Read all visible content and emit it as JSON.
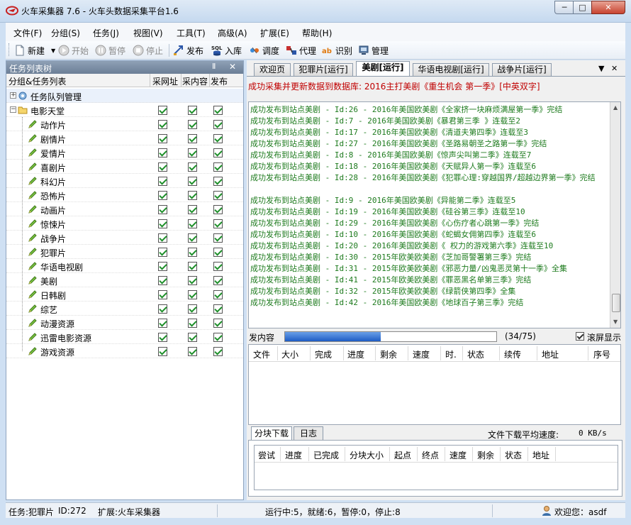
{
  "window": {
    "title": "火车采集器 7.6 - 火车头数据采集平台1.6",
    "min": "─",
    "max": "□",
    "close": "✕"
  },
  "menu": [
    "文件(F)",
    "分组(S)",
    "任务(J)",
    "视图(V)",
    "工具(T)",
    "高级(A)",
    "扩展(E)",
    "帮助(H)"
  ],
  "toolbar": {
    "new": "新建",
    "start": "开始",
    "pause": "暂停",
    "stop": "停止",
    "publish": "发布",
    "import": "入库",
    "schedule": "调度",
    "proxy": "代理",
    "recognize": "识别",
    "manage": "管理"
  },
  "task_tree": {
    "panel_title": "任务列表树",
    "pin": "Ⅱ",
    "close": "✕",
    "columns": [
      "分组&任务列表",
      "采网址",
      "采内容",
      "发布"
    ],
    "queue_label": "任务队列管理",
    "group_label": "电影天堂",
    "items": [
      "动作片",
      "剧情片",
      "爱情片",
      "喜剧片",
      "科幻片",
      "恐怖片",
      "动画片",
      "惊悚片",
      "战争片",
      "犯罪片",
      "华语电视剧",
      "美剧",
      "日韩剧",
      "综艺",
      "动漫资源",
      "迅雷电影资源",
      "游戏资源"
    ]
  },
  "tabs": {
    "items": [
      "欢迎页",
      "犯罪片[运行]",
      "美剧[运行]",
      "华语电视剧[运行]",
      "战争片[运行]"
    ],
    "active": 2,
    "menu": "▼",
    "close": "✕"
  },
  "status_message": "成功采集并更新数据到数据库: 2016主打美剧《重生机会 第一季》[中英双字]",
  "log": [
    "成功发布到站点美剧 - Id:26 - 2016年美国欧美剧《全家挤一块麻烦满屋第一季》完结",
    "成功发布到站点美剧 - Id:7 - 2016年美国欧美剧《暴君第三季 》连载至2",
    "成功发布到站点美剧 - Id:17 - 2016年美国欧美剧《清道夫第四季》连载至3",
    "成功发布到站点美剧 - Id:27 - 2016年美国欧美剧《圣路易朝圣之路第一季》完结",
    "成功发布到站点美剧 - Id:8 - 2016年美国欧美剧《惊声尖叫第二季》连载至7",
    "成功发布到站点美剧 - Id:18 - 2016年美国欧美剧《天赋异人第一季》连载至6",
    "成功发布到站点美剧 - Id:28 - 2016年美国欧美剧《犯罪心理:穿越国界/超越边界第一季》完结",
    "成功发布到站点美剧 - Id:9 - 2016年美国欧美剧《异能第二季》连载至5",
    "成功发布到站点美剧 - Id:19 - 2016年美国欧美剧《硅谷第三季》连载至10",
    "成功发布到站点美剧 - Id:29 - 2016年美国欧美剧《心伤疗者心跳第一季》完结",
    "成功发布到站点美剧 - Id:10 - 2016年美国欧美剧《蛇蝎女佣第四季》连载至6",
    "成功发布到站点美剧 - Id:20 - 2016年美国欧美剧《 权力的游戏第六季》连载至10",
    "成功发布到站点美剧 - Id:30 - 2015年欧美欧美剧《芝加哥警署第三季》完结",
    "成功发布到站点美剧 - Id:31 - 2015年欧美欧美剧《邪恶力量/凶鬼恶灵第十一季》全集",
    "成功发布到站点美剧 - Id:41 - 2015年欧美欧美剧《罪恶黑名单第三季》完结",
    "成功发布到站点美剧 - Id:32 - 2015年欧美欧美剧《绿箭侠第四季》全集",
    "成功发布到站点美剧 - Id:42 - 2016年美国欧美剧《地球百子第三季》完结"
  ],
  "progress": {
    "label": "发内容",
    "done": 34,
    "total": 75,
    "count_text": "(34/75)",
    "autoscroll_label": "滚屏显示"
  },
  "file_table": {
    "columns": [
      "文件",
      "大小",
      "完成",
      "进度",
      "剩余",
      "速度",
      "时.",
      "状态",
      "续传",
      "地址",
      "序号"
    ]
  },
  "lower_tabs": {
    "items": [
      "分块下载",
      "日志"
    ],
    "active": 0,
    "speed_label": "文件下载平均速度:",
    "speed_value": "0 KB/s"
  },
  "chunk_table": {
    "columns": [
      "尝试",
      "进度",
      "已完成",
      "分块大小",
      "起点",
      "终点",
      "速度",
      "剩余",
      "状态",
      "地址"
    ]
  },
  "statusbar": {
    "task": "任务:犯罪片",
    "id": "ID:272",
    "extension": "扩展:火车采集器",
    "counts": "运行中:5，就绪:6，暂停:0，停止:8",
    "welcome": "欢迎您：asdf"
  }
}
